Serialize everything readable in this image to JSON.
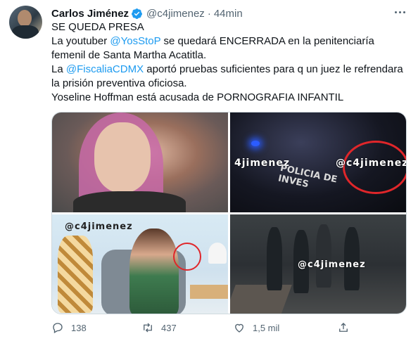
{
  "tweet": {
    "author_name": "Carlos Jiménez",
    "handle": "@c4jimenez",
    "separator": "·",
    "time": "44min",
    "lines": [
      {
        "parts": [
          {
            "text": "SE QUEDA PRESA",
            "type": "text"
          }
        ]
      },
      {
        "parts": [
          {
            "text": "La youtuber ",
            "type": "text"
          },
          {
            "text": "@YosStoP",
            "type": "mention"
          },
          {
            "text": " se quedará ENCERRADA en la penitenciaría femenil de Santa Martha Acatitla.",
            "type": "text"
          }
        ]
      },
      {
        "parts": [
          {
            "text": "La ",
            "type": "text"
          },
          {
            "text": "@FiscaliaCDMX",
            "type": "mention"
          },
          {
            "text": " aportó pruebas suficientes para q un juez le refrendara la prisión preventiva oficiosa.",
            "type": "text"
          }
        ]
      },
      {
        "parts": [
          {
            "text": "Yoseline Hoffman está acusada de PORNOGRAFIA INFANTIL",
            "type": "text"
          }
        ]
      }
    ]
  },
  "media": {
    "watermarks": {
      "tile2_left": "4jimenez",
      "tile2_circle": "@c4jimenez",
      "tile2_police": "POLICIA DE INVES",
      "tile3": "@c4jimenez",
      "tile4_mid": "@c4jimenez"
    }
  },
  "actions": {
    "reply_count": "138",
    "retweet_count": "437",
    "like_count": "1,5 mil"
  },
  "colors": {
    "accent": "#1d9bf0",
    "text": "#0f1419",
    "muted": "#536471",
    "circle_red": "#e0262a"
  },
  "icons": [
    "verified-badge-icon",
    "more-options-icon",
    "reply-icon",
    "retweet-icon",
    "like-icon",
    "share-icon"
  ]
}
